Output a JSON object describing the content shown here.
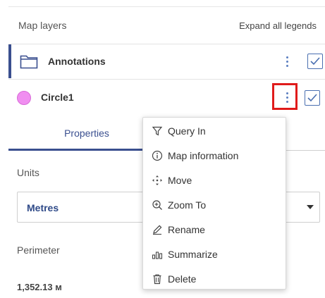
{
  "panel": {
    "title": "Map layers",
    "expand_all": "Expand all legends"
  },
  "layers": [
    {
      "name": "Annotations",
      "type": "group",
      "checked": true,
      "icon": "folder-icon"
    },
    {
      "name": "Circle1",
      "type": "feature",
      "checked": true,
      "icon": "circle-icon",
      "color": "#f08ef0"
    }
  ],
  "tabs": {
    "properties": "Properties"
  },
  "fields": {
    "units_label": "Units",
    "units_value": "Metres",
    "perimeter_label": "Perimeter",
    "perimeter_value": "1,352.13 м"
  },
  "context_menu": {
    "items": [
      {
        "label": "Query In",
        "icon": "filter-icon"
      },
      {
        "label": "Map information",
        "icon": "info-icon"
      },
      {
        "label": "Move",
        "icon": "move-icon"
      },
      {
        "label": "Zoom To",
        "icon": "zoom-in-icon"
      },
      {
        "label": "Rename",
        "icon": "pencil-icon"
      },
      {
        "label": "Summarize",
        "icon": "bar-chart-icon"
      },
      {
        "label": "Delete",
        "icon": "trash-icon"
      }
    ]
  },
  "colors": {
    "accent": "#3a4f8f",
    "kebab": "#5b7fc0",
    "highlight": "#e01b1b"
  }
}
